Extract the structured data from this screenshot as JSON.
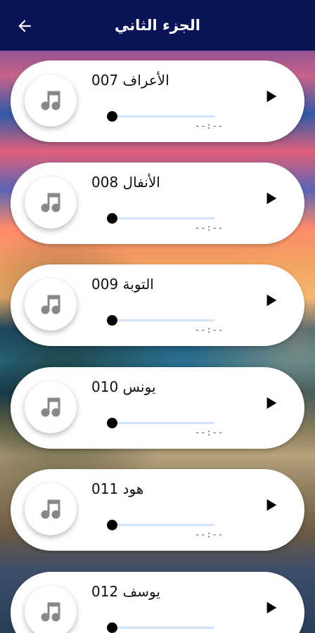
{
  "header": {
    "title": "الجزء الثاني",
    "back_icon": "arrow-left-icon"
  },
  "colors": {
    "appbar": "#0b1357",
    "track": "#cfe3fa",
    "card": "#ffffff"
  },
  "tracks": [
    {
      "name": "الأعراف 007",
      "time": "--:--",
      "progress": 0
    },
    {
      "name": "الأنفال 008",
      "time": "--:--",
      "progress": 0
    },
    {
      "name": "التوبة 009",
      "time": "--:--",
      "progress": 0
    },
    {
      "name": "يونس 010",
      "time": "--:--",
      "progress": 0
    },
    {
      "name": "هود 011",
      "time": "--:--",
      "progress": 0
    },
    {
      "name": "يوسف 012",
      "time": "--:--",
      "progress": 0
    }
  ],
  "icons": {
    "track_icon": "music-note-icon",
    "play_icon": "play-icon"
  }
}
